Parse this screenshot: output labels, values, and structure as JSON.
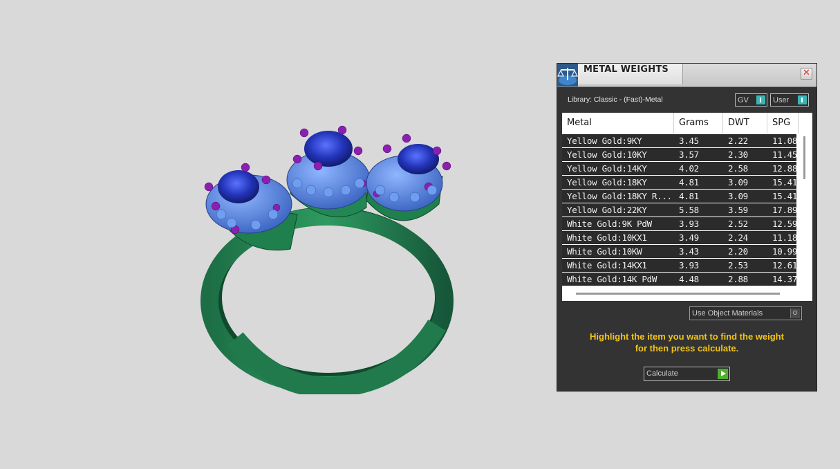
{
  "panel": {
    "title": "METAL WEIGHTS",
    "close_glyph": "✕",
    "library_label": "Library: Classic - (Fast)-Metal",
    "toggles": {
      "gv_label": "GV",
      "user_label": "User"
    },
    "use_object_materials_label": "Use Object Materials",
    "instruction_line1": "Highlight the item you want to find the weight",
    "instruction_line2": "for then press calculate.",
    "calculate_label": "Calculate",
    "colors": {
      "instruction": "#f2c418",
      "toggle_indicator": "#3ab5b5",
      "calculate_indicator": "#4fae2f"
    }
  },
  "table": {
    "columns": [
      "Metal",
      "Grams",
      "DWT",
      "SPG"
    ],
    "rows": [
      {
        "metal": "Yellow Gold:9KY",
        "grams": "3.45",
        "dwt": "2.22",
        "spg": "11.08"
      },
      {
        "metal": "Yellow Gold:10KY",
        "grams": "3.57",
        "dwt": "2.30",
        "spg": "11.45"
      },
      {
        "metal": "Yellow Gold:14KY",
        "grams": "4.02",
        "dwt": "2.58",
        "spg": "12.88"
      },
      {
        "metal": "Yellow Gold:18KY",
        "grams": "4.81",
        "dwt": "3.09",
        "spg": "15.41"
      },
      {
        "metal": "Yellow Gold:18KY R...",
        "grams": "4.81",
        "dwt": "3.09",
        "spg": "15.41"
      },
      {
        "metal": "Yellow Gold:22KY",
        "grams": "5.58",
        "dwt": "3.59",
        "spg": "17.89"
      },
      {
        "metal": "White Gold:9K PdW",
        "grams": "3.93",
        "dwt": "2.52",
        "spg": "12.59"
      },
      {
        "metal": "White Gold:10KX1",
        "grams": "3.49",
        "dwt": "2.24",
        "spg": "11.18"
      },
      {
        "metal": "White Gold:10KW",
        "grams": "3.43",
        "dwt": "2.20",
        "spg": "10.99"
      },
      {
        "metal": "White Gold:14KX1",
        "grams": "3.93",
        "dwt": "2.53",
        "spg": "12.61"
      },
      {
        "metal": "White Gold:14K PdW",
        "grams": "4.48",
        "dwt": "2.88",
        "spg": "14.37"
      }
    ]
  },
  "viewport": {
    "object": "three-stone-halo-ring-model",
    "colors": {
      "band": "#1f7a4a",
      "stone": "#2b3fc4",
      "prong": "#8a1fb0",
      "halo": "#4a7fd6"
    }
  }
}
